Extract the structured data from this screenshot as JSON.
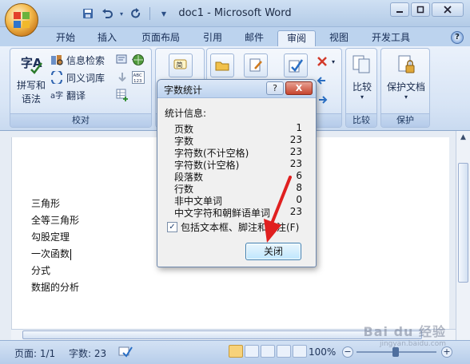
{
  "window": {
    "title": "doc1 - Microsoft Word"
  },
  "qat": {
    "save_icon": "save-icon",
    "undo_icon": "undo-icon",
    "redo_icon": "redo-icon",
    "customize": "▼"
  },
  "tabs": [
    {
      "label": "开始"
    },
    {
      "label": "插入"
    },
    {
      "label": "页面布局"
    },
    {
      "label": "引用"
    },
    {
      "label": "邮件"
    },
    {
      "label": "审阅"
    },
    {
      "label": "视图"
    },
    {
      "label": "开发工具"
    }
  ],
  "active_tab": "审阅",
  "ribbon": {
    "proofing": {
      "label": "校对",
      "spell_line1": "拼写和",
      "spell_line2": "语法",
      "research": "信息检索",
      "thesaurus": "同义词库",
      "translate": "翻译"
    },
    "compare": {
      "label": "比较"
    },
    "protect": {
      "label": "保护",
      "button": "保护文档"
    }
  },
  "document": {
    "lines": [
      "三角形",
      "全等三角形",
      "勾股定理",
      "一次函数",
      "分式",
      "数据的分析"
    ]
  },
  "dialog": {
    "title": "字数统计",
    "help": "?",
    "close_x": "X",
    "section": "统计信息:",
    "stats": [
      {
        "label": "页数",
        "value": "1"
      },
      {
        "label": "字数",
        "value": "23"
      },
      {
        "label": "字符数(不计空格)",
        "value": "23"
      },
      {
        "label": "字符数(计空格)",
        "value": "23"
      },
      {
        "label": "段落数",
        "value": "6"
      },
      {
        "label": "行数",
        "value": "8"
      },
      {
        "label": "非中文单词",
        "value": "0"
      },
      {
        "label": "中文字符和朝鲜语单词",
        "value": "23"
      }
    ],
    "checkbox_label": "包括文本框、脚注和尾注(F)",
    "checkbox_checked": "✓",
    "close_button": "关闭"
  },
  "statusbar": {
    "page": "页面: 1/1",
    "words": "字数: 23",
    "zoom": "100%"
  },
  "watermark": {
    "brand": "Bai du 经验",
    "url": "jingyan.baidu.com"
  },
  "colors": {
    "ribbon": "#d7e4f5",
    "accent_red": "#e02020"
  }
}
